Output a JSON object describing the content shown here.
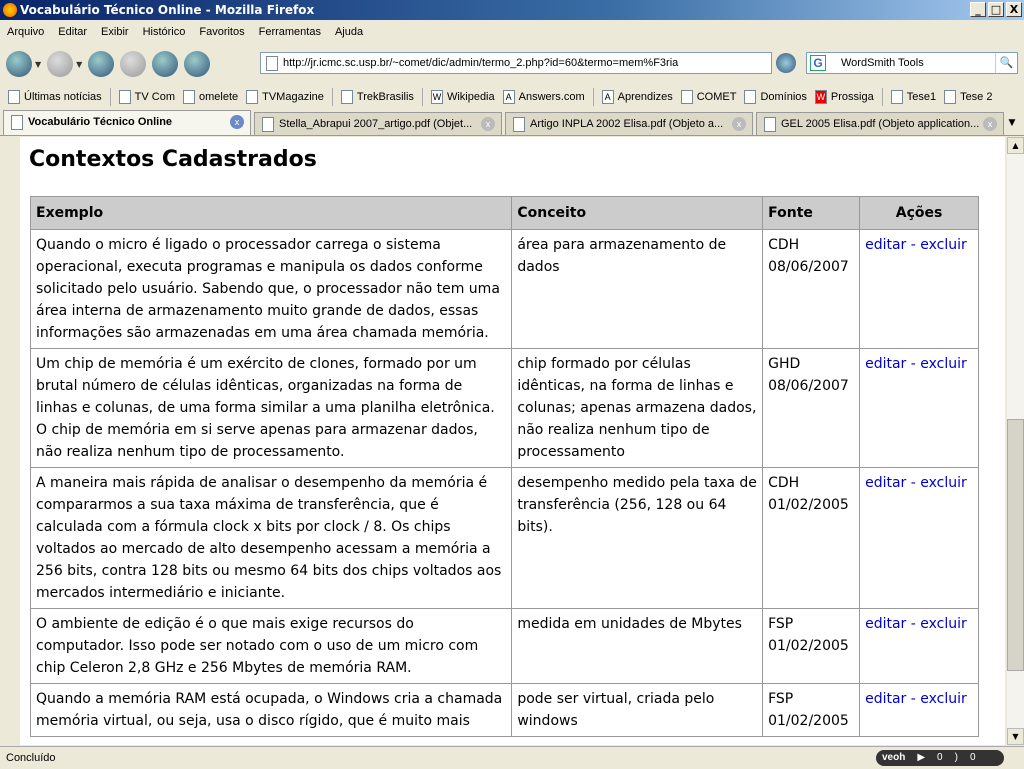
{
  "window": {
    "title": "Vocabulário Técnico Online - Mozilla Firefox"
  },
  "menu": [
    "Arquivo",
    "Editar",
    "Exibir",
    "Histórico",
    "Favoritos",
    "Ferramentas",
    "Ajuda"
  ],
  "nav": {
    "url": "http://jr.icmc.sc.usp.br/~comet/dic/admin/termo_2.php?id=60&termo=mem%F3ria",
    "search": "WordSmith Tools"
  },
  "bookmarks": [
    "Últimas notícias",
    "TV Com",
    "omelete",
    "TVMagazine",
    "TrekBrasilis",
    "Wikipedia",
    "Answers.com",
    "Aprendizes",
    "COMET",
    "Domínios",
    "Prossiga",
    "Tese1",
    "Tese 2"
  ],
  "tabs": [
    "Vocabulário Técnico Online",
    "Stella_Abrapui 2007_artigo.pdf (Objet...",
    "Artigo INPLA 2002 Elisa.pdf (Objeto a...",
    "GEL 2005 Elisa.pdf (Objeto application..."
  ],
  "page": {
    "title": "Contextos Cadastrados",
    "headers": [
      "Exemplo",
      "Conceito",
      "Fonte",
      "Ações"
    ],
    "edit": "editar",
    "sep": " - ",
    "delete": "excluir",
    "rows": [
      {
        "exemplo": "Quando o micro é ligado o processador carrega o sistema operacional, executa programas e manipula os dados conforme solicitado pelo usuário. Sabendo que, o processador não tem uma área interna de armazenamento muito grande de dados, essas informações são armazenadas em uma área chamada memória.",
        "conceito": "área para armazenamento de dados",
        "fonte": "CDH",
        "data": "08/06/2007"
      },
      {
        "exemplo": "Um chip de memória é um exército de clones, formado por um brutal número de células idênticas, organizadas na forma de linhas e colunas, de uma forma similar a uma planilha eletrônica. O chip de memória em si serve apenas para armazenar dados, não realiza nenhum tipo de processamento.",
        "conceito": "chip formado por células idênticas, na forma de linhas e colunas; apenas armazena dados, não realiza nenhum tipo de processamento",
        "fonte": "GHD",
        "data": "08/06/2007"
      },
      {
        "exemplo": "A maneira mais rápida de analisar o desempenho da memória é compararmos a sua taxa máxima de transferência, que é calculada com a fórmula clock x bits por clock / 8. Os chips voltados ao mercado de alto desempenho acessam a memória a 256 bits, contra 128 bits ou mesmo 64 bits dos chips voltados aos mercados intermediário e iniciante.",
        "conceito": "desempenho medido pela taxa de transferência (256, 128 ou 64 bits).",
        "fonte": "CDH",
        "data": "01/02/2005"
      },
      {
        "exemplo": "O ambiente de edição é o que mais exige recursos do computador. Isso pode ser notado com o uso de um micro com chip Celeron 2,8 GHz e 256 Mbytes de memória RAM.",
        "conceito": "medida em unidades de Mbytes",
        "fonte": "FSP",
        "data": "01/02/2005"
      },
      {
        "exemplo": "Quando a memória RAM está ocupada, o Windows cria a chamada memória virtual, ou seja, usa o disco rígido, que é muito mais",
        "conceito": "pode ser virtual, criada pelo windows",
        "fonte": "FSP",
        "data": "01/02/2005"
      }
    ]
  },
  "status": {
    "text": "Concluído",
    "veoh": "veoh",
    "count1": "0",
    "count2": "0"
  }
}
